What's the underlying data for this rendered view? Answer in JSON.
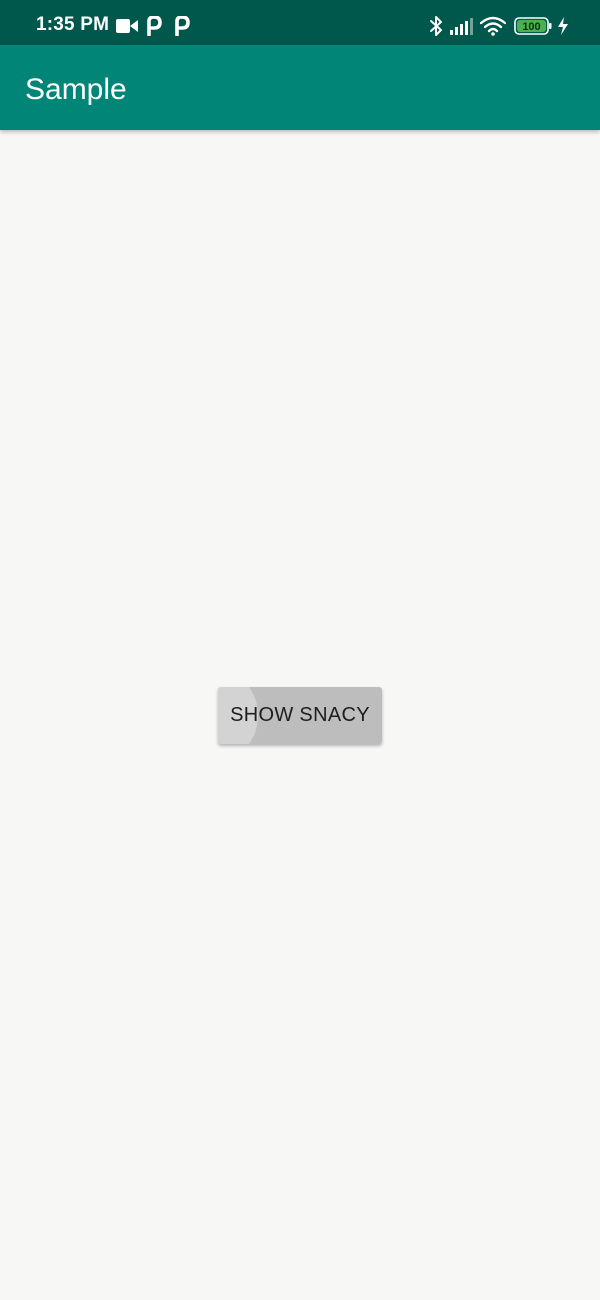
{
  "status_bar": {
    "time": "1:35 PM",
    "battery_level": "100",
    "icons": [
      "video-camera-icon",
      "p-notification-icon",
      "p-notification-icon",
      "bluetooth-icon",
      "signal-icon",
      "wifi-icon",
      "battery-icon",
      "charging-icon"
    ]
  },
  "app_bar": {
    "title": "Sample"
  },
  "main": {
    "button_label": "SHOW SNACY"
  },
  "colors": {
    "status_bar": "#00574b",
    "app_bar": "#008577",
    "background": "#f7f8f6",
    "button": "#bdbdbd",
    "battery_fill": "#4caf50"
  }
}
